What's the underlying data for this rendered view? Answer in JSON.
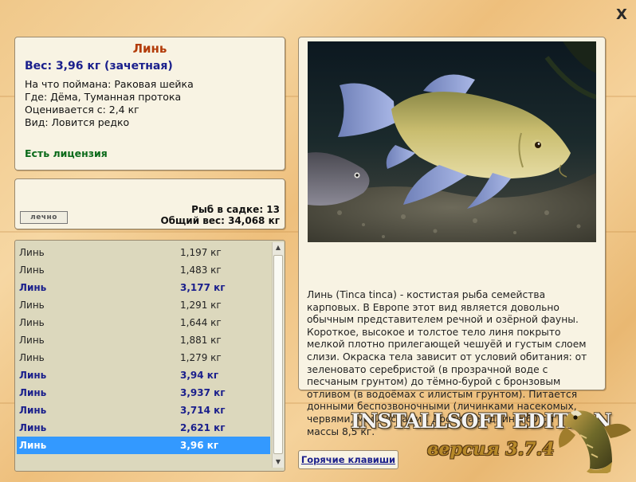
{
  "window": {
    "close_label": "X"
  },
  "fish": {
    "name": "Линь",
    "weight": "Вес: 3,96 кг (зачетная)",
    "bait": "На что поймана: Раковая шейка",
    "place": "Где: Дёма, Туманная протока",
    "value": "Оценивается с: 2,4 кг",
    "kind": "Вид: Ловится редко",
    "license": "Есть лицензия"
  },
  "catch": {
    "logo": "лечно",
    "count": "Рыб в садке: 13",
    "total": "Общий вес: 34,068 кг"
  },
  "list": {
    "rows": [
      {
        "name": "Линь",
        "weight": "1,197 кг"
      },
      {
        "name": "Линь",
        "weight": "1,483 кг"
      },
      {
        "name": "Линь",
        "weight": "3,177 кг"
      },
      {
        "name": "Линь",
        "weight": "1,291 кг"
      },
      {
        "name": "Линь",
        "weight": "1,644 кг"
      },
      {
        "name": "Линь",
        "weight": "1,881 кг"
      },
      {
        "name": "Линь",
        "weight": "1,279 кг"
      },
      {
        "name": "Линь",
        "weight": "3,94 кг"
      },
      {
        "name": "Линь",
        "weight": "3,937 кг"
      },
      {
        "name": "Линь",
        "weight": "3,714 кг"
      },
      {
        "name": "Линь",
        "weight": "2,621 кг"
      },
      {
        "name": "Линь",
        "weight": "3,96 кг"
      }
    ]
  },
  "description": "Линь (Tinca tinca) - костистая рыба семейства карповых. В Европе этот вид является довольно обычным представителем речной и озёрной фауны. Короткое, высокое и толстое тело линя покрыто мелкой плотно прилегающей чешуёй и густым слоем слизи. Окраска тела зависит от условий обитания: от зеленовато серебристой (в прозрачной воде с песчаным грунтом) до тёмно-бурой с бронзовым отливом (в водоёмах с илистым грунтом). Питается донными беспозвоночными (личинками насекомых, червями, моллюсками). Достигает длины 60 см и массы 8,5 кг.",
  "footer": {
    "hotkeys": "Горячие клавиши",
    "brand": "INSTALLSOFT EDITION",
    "version": "версия 3.7.4"
  },
  "colors": {
    "trophy_weight": "#1a1f8c",
    "selected_row": "#3399ff",
    "fish_name": "#b33c0a",
    "license": "#0a6a1a"
  }
}
